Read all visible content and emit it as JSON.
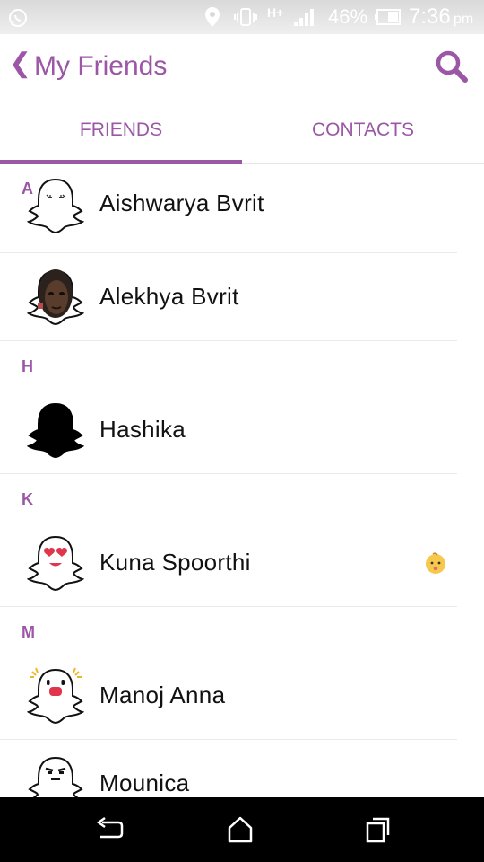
{
  "status_bar": {
    "battery": "46%",
    "time": "7:36",
    "ampm": "pm",
    "network": "H+"
  },
  "header": {
    "title": "My Friends",
    "back_icon": "chevron-left-icon",
    "search_icon": "search-icon"
  },
  "tabs": [
    {
      "label": "FRIENDS",
      "active": true
    },
    {
      "label": "CONTACTS",
      "active": false
    }
  ],
  "sections": [
    {
      "letter": "A",
      "friends": [
        {
          "name": "Aishwarya Bvrit",
          "avatar": "ghost-sleepy-icon"
        },
        {
          "name": "Alekhya Bvrit",
          "avatar": "photo-avatar"
        }
      ]
    },
    {
      "letter": "H",
      "friends": [
        {
          "name": "Hashika",
          "avatar": "ghost-black-icon"
        }
      ]
    },
    {
      "letter": "K",
      "friends": [
        {
          "name": "Kuna Spoorthi",
          "avatar": "ghost-heart-eyes-icon",
          "badge": "baby-emoji"
        }
      ]
    },
    {
      "letter": "M",
      "friends": [
        {
          "name": "Manoj Anna",
          "avatar": "ghost-excited-icon"
        },
        {
          "name": "Mounica",
          "avatar": "ghost-grumpy-icon"
        }
      ]
    }
  ],
  "colors": {
    "accent": "#9b57a6",
    "text": "#111111",
    "navbar": "#000000"
  }
}
